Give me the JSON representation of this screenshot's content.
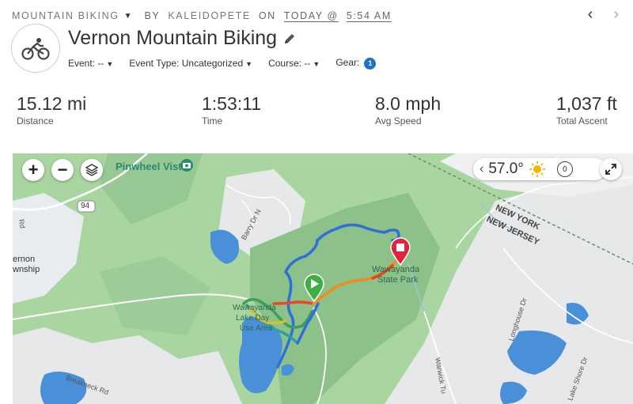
{
  "header": {
    "activity_type": "MOUNTAIN BIKING",
    "by_label": "BY",
    "author": "KALEIDOPETE",
    "on_label": "ON",
    "date_text": "TODAY @",
    "time": "5:54 AM",
    "prev_icon": "chevron-left-icon",
    "next_icon": "chevron-right-icon"
  },
  "activity": {
    "avatar_icon": "cyclist-icon",
    "title": "Vernon Mountain Biking",
    "edit_icon": "pencil-icon",
    "event_label": "Event: --",
    "event_type_label": "Event Type: Uncategorized",
    "course_label": "Course: --",
    "gear_label": "Gear:",
    "gear_count": "1"
  },
  "stats": [
    {
      "value": "15.12 mi",
      "label": "Distance"
    },
    {
      "value": "1:53:11",
      "label": "Time"
    },
    {
      "value": "8.0 mph",
      "label": "Avg Speed"
    },
    {
      "value": "1,037 ft",
      "label": "Total Ascent"
    }
  ],
  "map": {
    "controls": {
      "zoom_in": "+",
      "zoom_out": "−",
      "layers_icon": "layers-icon",
      "expand_icon": "expand-icon"
    },
    "weather": {
      "chevron": "‹",
      "temperature": "57.0°",
      "icon": "sun-icon",
      "wind_value": "0"
    },
    "labels": {
      "pinwheel": "Pinwheel Vista",
      "route94": "94",
      "vernon1": "ernon",
      "vernon2": "wnship",
      "barry": "Barry Dr N",
      "ny": "NEW YORK",
      "nj": "NEW JERSEY",
      "wawayanda1": "Wawayanda",
      "wawayanda2": "State Park",
      "lake1": "Wawayanda",
      "lake2": "Lake Day",
      "lake3": "Use Area",
      "breakneck": "Breakneck Rd",
      "warwick": "Warwick Tu",
      "longhouse": "Longhouse Dr",
      "lakeshore": "Lake Shore Dr",
      "rd1": "Rd"
    },
    "colors": {
      "forest": "#a9d5a0",
      "dark_forest": "#8cc18a",
      "water": "#4a90d9",
      "urban": "#e7eaed",
      "start_marker": "#3cb043",
      "end_marker": "#e0243c"
    }
  }
}
